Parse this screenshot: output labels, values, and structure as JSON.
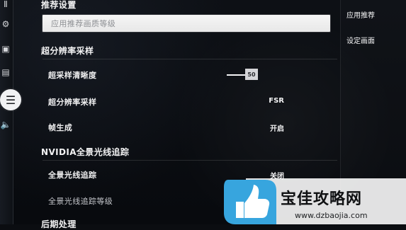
{
  "sections": {
    "recommended": "推荐设置",
    "super_resolution": "超分辨率采样",
    "nvidia": "NVIDIA全景光线追踪",
    "bottom_cut": "后期处理"
  },
  "rows": {
    "apply_recommended": "应用推荐画质等级",
    "super_sampling_sharpness": {
      "label": "超采样清晰度",
      "value": "50"
    },
    "super_resolution_sampling": {
      "label": "超分辨率采样",
      "value": "FSR"
    },
    "frame_generation": {
      "label": "帧生成",
      "value": "开启"
    },
    "panoramic_ray_tracing": {
      "label": "全景光线追踪",
      "value": "关闭"
    },
    "panoramic_ray_tracing_level": {
      "label": "全景光线追踪等级",
      "value": ""
    }
  },
  "right_pane": {
    "item1": "应用推荐",
    "item2": "设定画面"
  },
  "icons": {
    "rail_1": "pause-icon",
    "rail_2": "gear-icon",
    "rail_3": "monitor-icon",
    "rail_4": "display-icon",
    "rail_selected": "settings-selected-icon",
    "rail_5": "speaker-icon"
  },
  "watermark": {
    "title": "宝佳攻略网",
    "url": "www.dzbaojia.com"
  }
}
